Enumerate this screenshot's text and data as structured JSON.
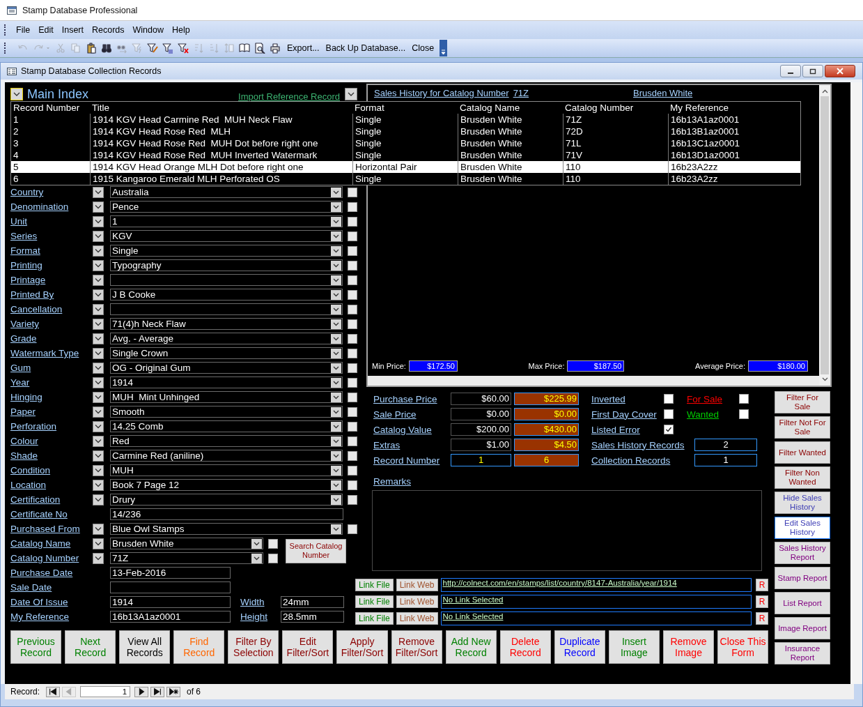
{
  "window": {
    "title": "Stamp Database Professional"
  },
  "menu": [
    "File",
    "Edit",
    "Insert",
    "Records",
    "Window",
    "Help"
  ],
  "toolbar": {
    "tools": [
      {
        "kind": "undo",
        "disabled": true
      },
      {
        "kind": "redo",
        "disabled": true
      },
      {
        "kind": "caret",
        "disabled": true
      },
      {
        "kind": "cut",
        "disabled": true
      },
      {
        "kind": "copy",
        "disabled": true
      },
      {
        "kind": "paste",
        "disabled": false
      },
      {
        "kind": "find",
        "disabled": false
      },
      {
        "kind": "replace",
        "disabled": true
      },
      {
        "kind": "filter-selection",
        "disabled": true
      },
      {
        "kind": "filter-form",
        "disabled": false
      },
      {
        "kind": "filter-apply",
        "disabled": false
      },
      {
        "kind": "filter-remove",
        "disabled": false
      },
      {
        "kind": "sort-asc",
        "disabled": true
      },
      {
        "kind": "sort-desc",
        "disabled": true
      },
      {
        "kind": "row-height",
        "disabled": true
      },
      {
        "kind": "book",
        "disabled": false
      },
      {
        "kind": "preview",
        "disabled": false
      },
      {
        "kind": "print",
        "disabled": false
      }
    ],
    "commands": [
      "Export...",
      "Back Up Database...",
      "Close"
    ]
  },
  "form": {
    "title": "Stamp Database Collection Records"
  },
  "header": {
    "title": "Main Index",
    "import_link": "Import Reference Record"
  },
  "index_list": {
    "columns": [
      "Record Number",
      "Title",
      "Format",
      "Catalog Name",
      "Catalog Number",
      "My Reference"
    ],
    "rows": [
      {
        "cells": [
          "1",
          "1914 KGV Head Carmine Red  MUH Neck Flaw",
          "Single",
          "Brusden White",
          "71Z",
          "16b13A1az0001"
        ],
        "selected": false
      },
      {
        "cells": [
          "2",
          "1914 KGV Head Rose Red  MLH",
          "Single",
          "Brusden White",
          "72D",
          "16b13B1az0001"
        ],
        "selected": false
      },
      {
        "cells": [
          "3",
          "1914 KGV Head Rose Red  MUH Dot before right one",
          "Single",
          "Brusden White",
          "71L",
          "16b13C1az0001"
        ],
        "selected": false
      },
      {
        "cells": [
          "4",
          "1914 KGV Head Rose Red  MUH Inverted Watermark",
          "Single",
          "Brusden White",
          "71V",
          "16b13D1az0001"
        ],
        "selected": false
      },
      {
        "cells": [
          "5",
          "1914 KGV Head Orange MLH Dot before right one",
          "Horizontal Pair",
          "Brusden White",
          "110",
          "16b23A2zz"
        ],
        "selected": true
      },
      {
        "cells": [
          "6",
          "1915 Kangaroo Emerald MLH Perforated OS",
          "Single",
          "Brusden White",
          "110",
          "16b23A2zz"
        ],
        "selected": false
      }
    ]
  },
  "fields": [
    {
      "kind": "combo",
      "label": "Country",
      "value": "Australia",
      "checked": false
    },
    {
      "kind": "combo",
      "label": "Denomination",
      "value": "Pence",
      "checked": false
    },
    {
      "kind": "combo",
      "label": "Unit",
      "value": "1",
      "checked": false
    },
    {
      "kind": "combo",
      "label": "Series",
      "value": "KGV",
      "checked": false
    },
    {
      "kind": "combo",
      "label": "Format",
      "value": "Single",
      "checked": false
    },
    {
      "kind": "combo",
      "label": "Printing",
      "value": "Typography",
      "checked": false
    },
    {
      "kind": "combo",
      "label": "Printage",
      "checked": false
    },
    {
      "kind": "combo",
      "label": "Printed By",
      "value": "J B Cooke",
      "checked": false
    },
    {
      "kind": "combo",
      "label": "Cancellation",
      "checked": false
    },
    {
      "kind": "combo",
      "label": "Variety",
      "value": "71(4)h Neck Flaw",
      "checked": false
    },
    {
      "kind": "combo",
      "label": "Grade",
      "value": "Avg. - Average",
      "checked": false
    },
    {
      "kind": "combo",
      "label": "Watermark Type",
      "value": "Single Crown",
      "checked": false
    },
    {
      "kind": "combo",
      "label": "Gum",
      "value": "OG - Original Gum",
      "checked": false
    },
    {
      "kind": "combo",
      "label": "Year",
      "value": "1914",
      "checked": false
    },
    {
      "kind": "combo",
      "label": "Hinging",
      "value": "MUH  Mint Unhinged",
      "checked": false
    },
    {
      "kind": "combo",
      "label": "Paper",
      "value": "Smooth",
      "checked": false
    },
    {
      "kind": "combo",
      "label": "Perforation",
      "value": "14.25 Comb",
      "checked": false
    },
    {
      "kind": "combo",
      "label": "Colour",
      "value": "Red",
      "checked": false
    },
    {
      "kind": "combo",
      "label": "Shade",
      "value": "Carmine Red (aniline)",
      "checked": false
    },
    {
      "kind": "combo",
      "label": "Condition",
      "value": "MUH",
      "checked": false
    },
    {
      "kind": "combo",
      "label": "Location",
      "value": "Book 7 Page 12",
      "checked": false
    },
    {
      "kind": "combo",
      "label": "Certification",
      "value": "Drury",
      "checked": false
    },
    {
      "kind": "text",
      "label": "Certificate No",
      "value": "14/236"
    },
    {
      "kind": "combo",
      "label": "Purchased From",
      "value": "Blue Owl Stamps",
      "checked": false
    }
  ],
  "catalog": {
    "rows": [
      {
        "label": "Catalog Name",
        "value": "Brusden White",
        "checked": false
      },
      {
        "label": "Catalog Number",
        "value": "71Z",
        "checked": false
      }
    ],
    "search_button": "Search Catalog Number"
  },
  "dates": [
    {
      "label": "Purchase Date",
      "value": "13-Feb-2016"
    },
    {
      "label": "Sale Date"
    },
    {
      "label": "Date Of Issue",
      "value": "1914",
      "side_label": "Width",
      "side_value": "24mm"
    },
    {
      "label": "My Reference",
      "value": "16b13A1az0001",
      "side_label": "Height",
      "side_value": "28.5mm"
    }
  ],
  "sales_history": {
    "title_link": "Sales History for Catalog Number",
    "catalog_number": "71Z",
    "catalog_name": "Brusden White",
    "stats": [
      {
        "label": "Min Price:",
        "value": "$172.50"
      },
      {
        "label": "Max Price:",
        "value": "$187.50"
      },
      {
        "label": "Average Price:",
        "value": "$180.00"
      }
    ]
  },
  "prices": [
    {
      "kind": "amount",
      "label": "Purchase Price",
      "value": "$60.00",
      "value_2": "$225.99"
    },
    {
      "kind": "amount",
      "label": "Sale Price",
      "value": "$0.00",
      "value_2": "$0.00"
    },
    {
      "kind": "amount",
      "label": "Catalog Value",
      "value": "$200.00",
      "value_2": "$430.00"
    },
    {
      "kind": "amount",
      "label": "Extras",
      "value": "$1.00",
      "value_2": "$4.50"
    },
    {
      "kind": "index",
      "label": "Record Number",
      "value": "1",
      "value_2": "6"
    }
  ],
  "flags": [
    {
      "label": "Inverted",
      "checked": false
    },
    {
      "label": "First Day Cover",
      "checked": false
    },
    {
      "label": "Listed Error",
      "checked": true
    }
  ],
  "status_flags": [
    {
      "label": "For Sale",
      "checked": false,
      "color": "#ff0000"
    },
    {
      "label": "Wanted",
      "checked": false,
      "color": "#00cc00"
    }
  ],
  "counts": [
    {
      "label": "Sales History Records",
      "value": "2"
    },
    {
      "label": "Collection Records",
      "value": "1"
    }
  ],
  "remarks": {
    "label": "Remarks"
  },
  "links": [
    {
      "file_button": "Link File",
      "web_button": "Link Web",
      "url": "http://colnect.com/en/stamps/list/country/8147-Australia/year/1914",
      "remove_button": "R"
    },
    {
      "file_button": "Link File",
      "web_button": "Link Web",
      "url": "No Link Selected",
      "remove_button": "R"
    },
    {
      "file_button": "Link File",
      "web_button": "Link Web",
      "url": "No Link Selected",
      "remove_button": "R"
    }
  ],
  "side_buttons": [
    {
      "label": "Filter For Sale",
      "color": "#8b0000",
      "focused": false
    },
    {
      "label": "Filter Not For Sale",
      "color": "#8b0000",
      "focused": false
    },
    {
      "label": "Filter Wanted",
      "color": "#8b0000",
      "focused": false
    },
    {
      "label": "Filter Non Wanted",
      "color": "#8b0000",
      "focused": false
    },
    {
      "label": "Hide Sales History",
      "color": "#3c3cb4",
      "focused": false
    },
    {
      "label": "Edit Sales History",
      "color": "#3c3cb4",
      "focused": true
    },
    {
      "label": "Sales History Report",
      "color": "#800080",
      "focused": false
    },
    {
      "label": "Stamp Report",
      "color": "#800080",
      "focused": false
    },
    {
      "label": "List Report",
      "color": "#800080",
      "focused": false
    },
    {
      "label": "Image Report",
      "color": "#800080",
      "focused": false
    },
    {
      "label": "Insurance Report",
      "color": "#800080",
      "focused": false
    }
  ],
  "bottom_buttons": [
    {
      "label": "Previous Record",
      "color": "#008000"
    },
    {
      "label": "Next Record",
      "color": "#008000"
    },
    {
      "label": "View All Records",
      "color": "#000000"
    },
    {
      "label": "Find Record",
      "color": "#ff6600"
    },
    {
      "label": "Filter By Selection",
      "color": "#8b0000"
    },
    {
      "label": "Edit Filter/Sort",
      "color": "#8b0000"
    },
    {
      "label": "Apply Filter/Sort",
      "color": "#8b0000"
    },
    {
      "label": "Remove Filter/Sort",
      "color": "#8b0000"
    },
    {
      "label": "Add New Record",
      "color": "#008000"
    },
    {
      "label": "Delete Record",
      "color": "#ff0000"
    },
    {
      "label": "Duplicate Record",
      "color": "#0000ff"
    },
    {
      "label": "Insert Image",
      "color": "#008000"
    },
    {
      "label": "Remove Image",
      "color": "#ff0000"
    },
    {
      "label": "Close This Form",
      "color": "#ff0000"
    }
  ],
  "status_bar": {
    "label": "Record:",
    "current": "1",
    "total": "of 6",
    "nav": [
      {
        "kind": "first",
        "disabled": false
      },
      {
        "kind": "prev",
        "disabled": true
      },
      {
        "kind": "next",
        "disabled": false
      },
      {
        "kind": "last",
        "disabled": false
      },
      {
        "kind": "new",
        "disabled": false
      }
    ]
  }
}
